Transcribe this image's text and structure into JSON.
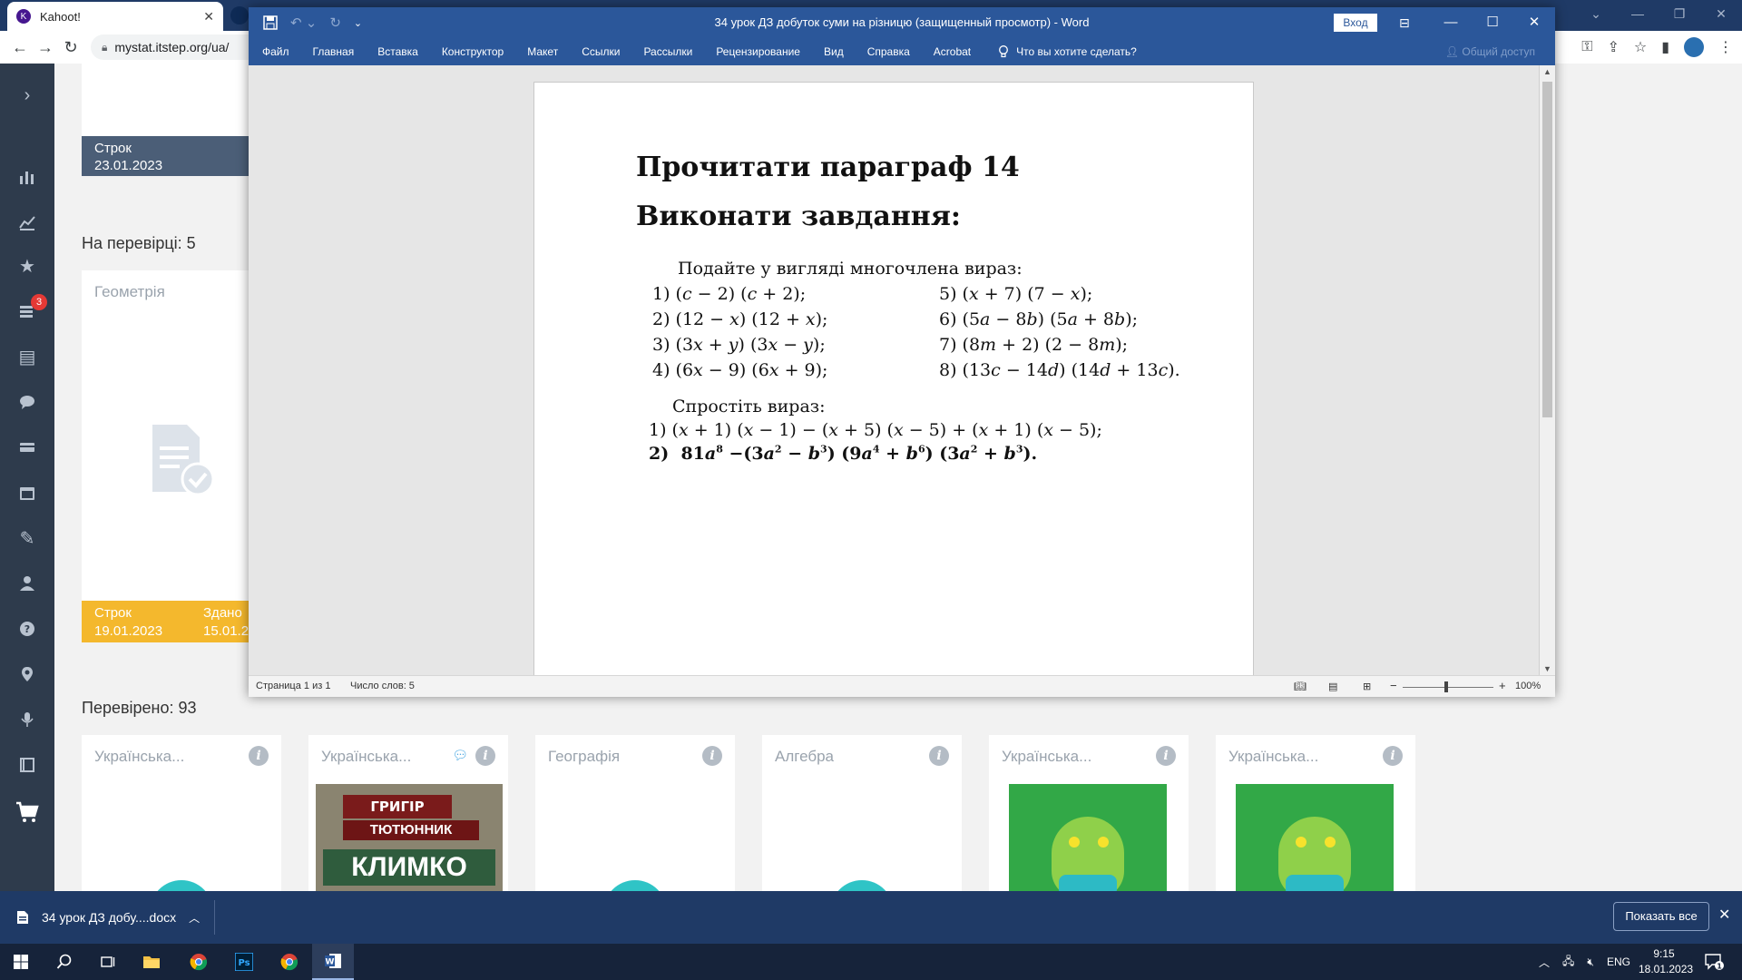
{
  "browser": {
    "tab_title": "Kahoot!",
    "tab_close": "✕",
    "url": "mystat.itstep.org/ua/"
  },
  "sidebar": {
    "badge": "3"
  },
  "mystat": {
    "deadline_label": "Строк",
    "deadline_date": "23.01.2023",
    "on_review": "На перевірці: 5",
    "subject": "Геометрія",
    "yellow_deadline_label": "Строк",
    "yellow_deadline_date": "19.01.2023",
    "submitted_label": "Здано",
    "submitted_date": "15.01.2",
    "checked": "Перевірено: 93",
    "cards": [
      {
        "title": "Українська..."
      },
      {
        "title": "Українська..."
      },
      {
        "title": "Географія"
      },
      {
        "title": "Алгебра"
      },
      {
        "title": "Українська..."
      },
      {
        "title": "Українська..."
      }
    ],
    "book": {
      "line1": "ГРИГІР",
      "line2": "ТЮТЮННИК",
      "line3": "КЛИМКО"
    },
    "info_glyph": "i"
  },
  "word": {
    "title": "34 урок ДЗ добуток суми на різницю (защищенный просмотр)  -  Word",
    "sign_in": "Вход",
    "menu": [
      "Файл",
      "Главная",
      "Вставка",
      "Конструктор",
      "Макет",
      "Ссылки",
      "Рассылки",
      "Рецензирование",
      "Вид",
      "Справка",
      "Acrobat"
    ],
    "tell_me": "Что вы хотите сделать?",
    "share": "Общий доступ",
    "status_page": "Страница 1 из 1",
    "status_words": "Число слов: 5",
    "zoom": "100%",
    "doc": {
      "heading1": "Прочитати параграф 14",
      "heading2": "Виконати завдання:",
      "intro1": "Подайте у вигляді многочлена вираз:",
      "intro2": "Спростіть вираз:"
    }
  },
  "downloads": {
    "file": "34 урок ДЗ добу....docx",
    "show_all": "Показать все"
  },
  "taskbar": {
    "lang": "ENG",
    "time": "9:15",
    "date": "18.01.2023",
    "notifications": "1"
  }
}
